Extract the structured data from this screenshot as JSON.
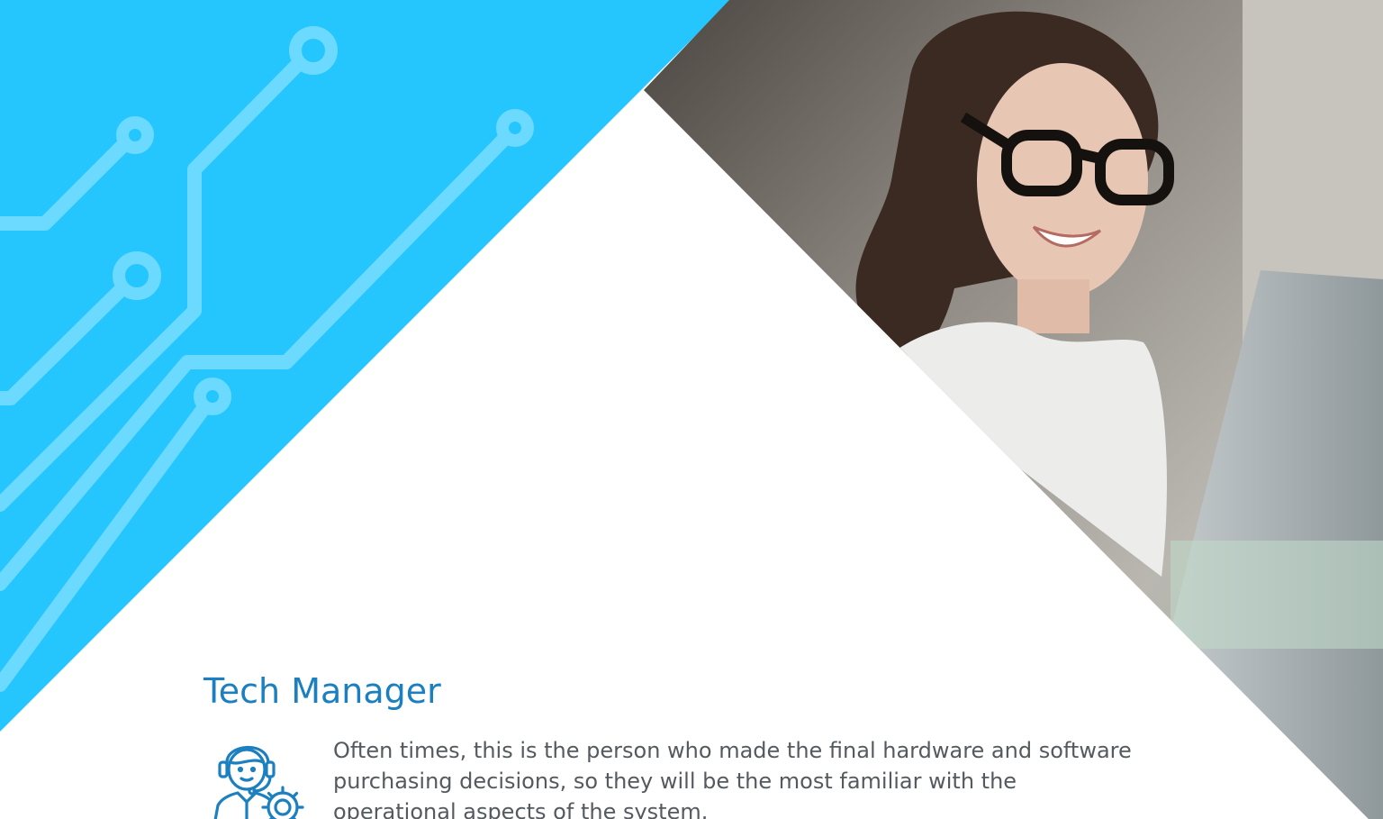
{
  "role": {
    "title": "Tech Manager",
    "description": "Often times, this is the person who made the final hardware and software purchasing decisions, so they will be the most familiar with the operational aspects of the system."
  },
  "icons": {
    "role_icon": "support-agent-gear-icon"
  },
  "colors": {
    "accent_blue": "#25c6fe",
    "circuit_lines": "#6cd9ff",
    "title_blue": "#1c7fc0",
    "body_text": "#555a5e"
  }
}
